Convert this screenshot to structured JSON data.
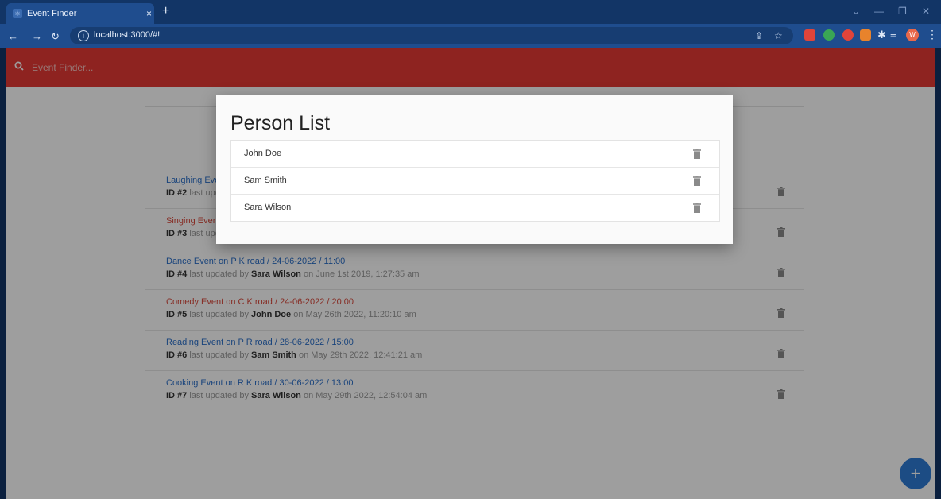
{
  "browser": {
    "tab_title": "Event Finder",
    "tab_close": "×",
    "new_tab": "+",
    "url": "localhost:3000/#!",
    "profile_initial": "W"
  },
  "app": {
    "search_placeholder": "Event Finder...",
    "fab_label": "+"
  },
  "events": [
    {
      "title": "Laughing Event on …",
      "id": "ID #2",
      "text": " last updated by …"
    },
    {
      "title": "Singing Event on …",
      "id": "ID #3",
      "text": " last updated by …"
    },
    {
      "title": "Dance Event on P K road / 24-06-2022 / 11:00",
      "id": "ID #4",
      "by_label": " last updated by ",
      "user": "Sara Wilson",
      "date": " on June 1st 2019, 1:27:35 am"
    },
    {
      "title": "Comedy Event on C K road / 24-06-2022 / 20:00",
      "id": "ID #5",
      "by_label": " last updated by ",
      "user": "John Doe",
      "date": " on May 26th 2022, 11:20:10 am"
    },
    {
      "title": "Reading Event on P R road / 28-06-2022 / 15:00",
      "id": "ID #6",
      "by_label": " last updated by ",
      "user": "Sam Smith",
      "date": " on May 29th 2022, 12:41:21 am"
    },
    {
      "title": "Cooking Event on R K road / 30-06-2022 / 13:00",
      "id": "ID #7",
      "by_label": " last updated by ",
      "user": "Sara Wilson",
      "date": " on May 29th 2022, 12:54:04 am"
    }
  ],
  "modal": {
    "title": "Person List",
    "persons": [
      "John Doe",
      "Sam Smith",
      "Sara Wilson"
    ]
  },
  "colors": {
    "appbar": "#e53935",
    "link_blue": "#2a6fc9",
    "link_red": "#d9473a",
    "fab": "#2e7bd6"
  }
}
